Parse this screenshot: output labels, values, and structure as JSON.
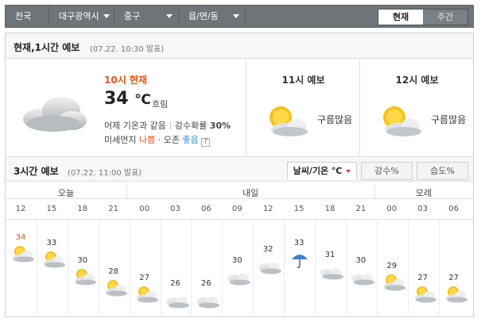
{
  "nav": {
    "regions": [
      {
        "label": "전국",
        "dropdown": false
      },
      {
        "label": "대구광역시",
        "dropdown": true
      },
      {
        "label": "중구",
        "dropdown": true
      },
      {
        "label": "읍/면/동",
        "dropdown": true
      }
    ],
    "tabs": [
      {
        "label": "현재",
        "active": true
      },
      {
        "label": "주간",
        "active": false
      }
    ]
  },
  "current_section": {
    "title": "현재,1시간 예보",
    "subtitle": "(07.22. 10:30 발표)",
    "now": {
      "time_label": "10시 현재",
      "temperature": "34",
      "unit": "℃",
      "condition": "흐림",
      "compare_label": "어제 기온과 같음",
      "precip_label": "강수확률",
      "precip_value": "30%",
      "dust_label": "미세먼지",
      "dust_value": "나쁨",
      "ozone_label": "· 오존",
      "ozone_value": "좋음",
      "help": "?",
      "icon": "cloud-icon"
    },
    "hourly": [
      {
        "title": "11시 예보",
        "desc": "구름많음",
        "icon": "partly-cloudy-icon"
      },
      {
        "title": "12시 예보",
        "desc": "구름많음",
        "icon": "partly-cloudy-icon"
      }
    ]
  },
  "three_hour_section": {
    "title": "3시간 예보",
    "subtitle": "(07.22. 11:00 발표)",
    "tabs": [
      {
        "label": "날씨/기온 ℃",
        "active": true
      },
      {
        "label": "강수%",
        "active": false
      },
      {
        "label": "습도%",
        "active": false
      }
    ],
    "days": [
      "오늘",
      "내일",
      "모레"
    ],
    "hours": [
      "12",
      "15",
      "18",
      "21",
      "00",
      "03",
      "06",
      "09",
      "12",
      "15",
      "18",
      "21",
      "00",
      "03",
      "06"
    ],
    "temps": [
      "34",
      "33",
      "30",
      "28",
      "27",
      "26",
      "26",
      "30",
      "32",
      "33",
      "31",
      "30",
      "29",
      "27",
      "27"
    ],
    "conditions": [
      "partly-cloudy",
      "partly-cloudy",
      "partly-cloudy",
      "partly-cloudy",
      "partly-cloudy",
      "cloudy",
      "cloudy",
      "cloudy",
      "cloudy",
      "rain",
      "cloudy",
      "cloudy",
      "partly-cloudy",
      "partly-cloudy",
      "partly-cloudy"
    ],
    "chart_data": {
      "type": "line",
      "x": [
        "12",
        "15",
        "18",
        "21",
        "00",
        "03",
        "06",
        "09",
        "12",
        "15",
        "18",
        "21",
        "00",
        "03",
        "06"
      ],
      "series": [
        {
          "values": [
            34,
            33,
            30,
            28,
            27,
            26,
            26,
            30,
            32,
            33,
            31,
            30,
            29,
            27,
            27
          ]
        }
      ],
      "ylim": [
        25,
        35
      ]
    }
  },
  "colors": {
    "accent": "#e8521a",
    "nav_bg": "#6f7479",
    "good": "#3b8fd8"
  }
}
